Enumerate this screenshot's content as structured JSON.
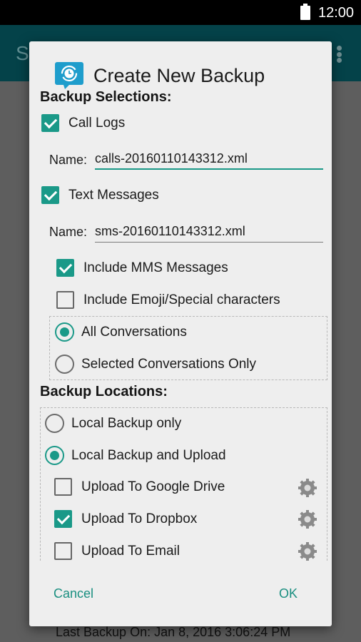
{
  "status_bar": {
    "time": "12:00",
    "battery_icon": "battery-full-icon"
  },
  "background": {
    "app_title_partial": "S",
    "overflow_icon": "more-vert-icon",
    "last_backup": "Last Backup On: Jan 8, 2016 3:06:24 PM"
  },
  "dialog": {
    "icon": "backup-clock-icon",
    "title": "Create New Backup",
    "selections_heading": "Backup Selections:",
    "call_logs": {
      "label": "Call Logs",
      "checked": true,
      "name_label": "Name:",
      "name_value": "calls-20160110143312.xml"
    },
    "text_messages": {
      "label": "Text Messages",
      "checked": true,
      "name_label": "Name:",
      "name_value": "sms-20160110143312.xml"
    },
    "include_mms": {
      "label": "Include MMS Messages",
      "checked": true
    },
    "include_emoji": {
      "label": "Include Emoji/Special characters",
      "checked": false
    },
    "conversations": [
      {
        "label": "All Conversations",
        "selected": true
      },
      {
        "label": "Selected Conversations Only",
        "selected": false
      }
    ],
    "locations_heading": "Backup Locations:",
    "locations": [
      {
        "label": "Local Backup only",
        "selected": false
      },
      {
        "label": "Local Backup and Upload",
        "selected": true
      }
    ],
    "uploads": [
      {
        "label": "Upload To Google Drive",
        "checked": false,
        "settings_icon": "gear-icon"
      },
      {
        "label": "Upload To Dropbox",
        "checked": true,
        "settings_icon": "gear-icon"
      },
      {
        "label": "Upload To Email",
        "checked": false,
        "settings_icon": "gear-icon"
      }
    ],
    "cancel_label": "Cancel",
    "ok_label": "OK"
  },
  "colors": {
    "accent": "#1a9988",
    "app_bar": "#044249",
    "dialog_bg": "#eeeeee"
  }
}
